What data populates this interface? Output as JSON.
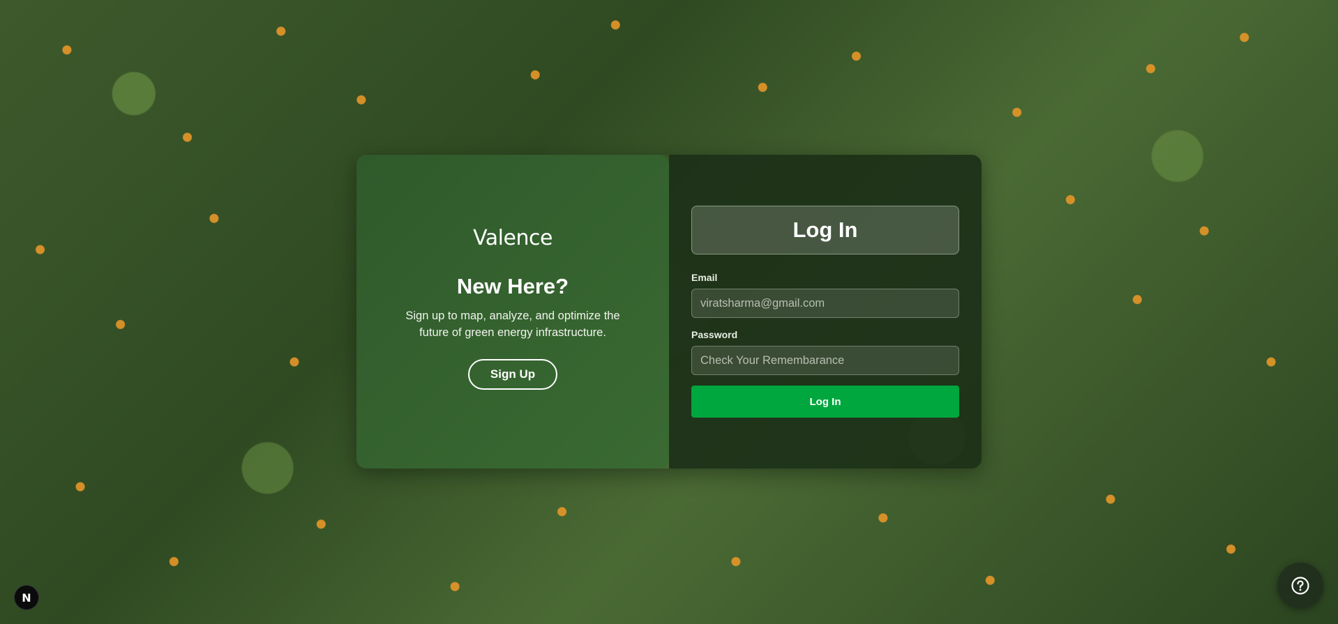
{
  "brand": {
    "logo_text": "Valence"
  },
  "signup_panel": {
    "heading": "New Here?",
    "description": "Sign up to map, analyze, and optimize the future of green energy infrastructure.",
    "signup_button": "Sign Up"
  },
  "login_panel": {
    "title": "Log In",
    "email": {
      "label": "Email",
      "value": "",
      "placeholder": "viratsharma@gmail.com"
    },
    "password": {
      "label": "Password",
      "value": "",
      "placeholder": "Check Your Remembarance"
    },
    "login_button": "Log In"
  },
  "corner": {
    "nextjs_badge": "N",
    "help_icon": "question-circle-icon"
  },
  "colors": {
    "accent_green": "#00a63e",
    "left_panel": "#2f5a2b",
    "right_panel": "#1c3018"
  }
}
